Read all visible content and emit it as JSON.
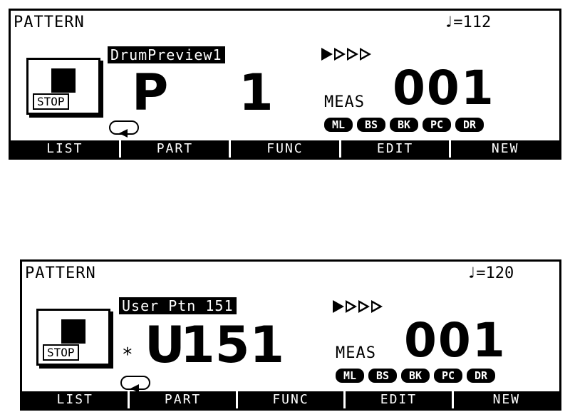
{
  "displays": [
    {
      "mode_title": "PATTERN",
      "tempo": "♩=112",
      "stop_label": "STOP",
      "pattern_name": "DrumPreview1",
      "pattern_bank": "P",
      "pattern_number": "1",
      "modified_flag": "",
      "meas_label": "MEAS",
      "meas_value": "001",
      "beat_indicator": [
        "current",
        "off",
        "off",
        "off"
      ],
      "parts": [
        "ML",
        "BS",
        "BK",
        "PC",
        "DR"
      ],
      "function_keys": [
        "LIST",
        "PART",
        "FUNC",
        "EDIT",
        "NEW"
      ]
    },
    {
      "mode_title": "PATTERN",
      "tempo": "♩=120",
      "stop_label": "STOP",
      "pattern_name": "User Ptn 151",
      "pattern_bank": "U",
      "pattern_number": "151",
      "modified_flag": "*",
      "meas_label": "MEAS",
      "meas_value": "001",
      "beat_indicator": [
        "current",
        "off",
        "off",
        "off"
      ],
      "parts": [
        "ML",
        "BS",
        "BK",
        "PC",
        "DR"
      ],
      "function_keys": [
        "LIST",
        "PART",
        "FUNC",
        "EDIT",
        "NEW"
      ]
    }
  ]
}
